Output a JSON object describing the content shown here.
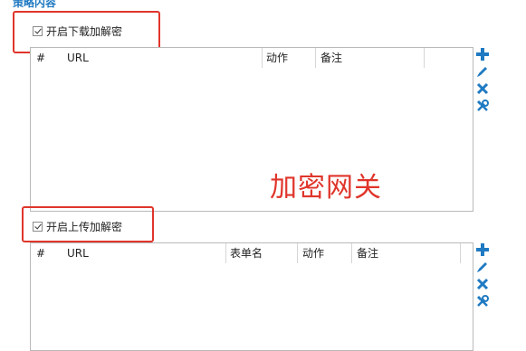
{
  "section": {
    "title": "策略内容"
  },
  "download": {
    "checkbox_label": "开启下载加解密",
    "checked": true,
    "columns": [
      "#",
      "URL",
      "动作",
      "备注"
    ]
  },
  "upload": {
    "checkbox_label": "开启上传加解密",
    "checked": true,
    "columns": [
      "#",
      "URL",
      "表单名",
      "动作",
      "备注"
    ]
  },
  "annotation": {
    "text": "加密网关"
  },
  "toolbar_icons": [
    "add-icon",
    "edit-icon",
    "delete-icon",
    "tools-icon"
  ],
  "colors": {
    "accent": "#1f7ac2",
    "highlight": "#e0352b"
  }
}
